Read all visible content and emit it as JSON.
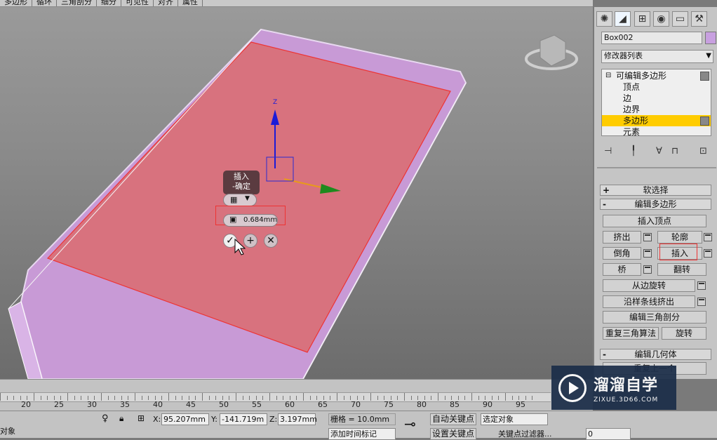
{
  "ribbon": {
    "tabs": [
      "多边形",
      "循环",
      "三角剖分",
      "细分",
      "可见性",
      "对齐",
      "属性"
    ]
  },
  "viewport": {
    "caddy": {
      "tooltip_line1": "插入",
      "tooltip_line2": "-确定",
      "amount_value": "0.684mm"
    },
    "gizmo_axis_z": "Z"
  },
  "command_panel": {
    "tab_icons": [
      "create-icon",
      "modify-icon",
      "hierarchy-icon",
      "motion-icon",
      "display-icon",
      "utilities-icon"
    ],
    "object_name": "Box002",
    "object_color": "#c8a0e0",
    "modifier_list_label": "修改器列表",
    "stack": {
      "root": "可编辑多边形",
      "sublevels": [
        "顶点",
        "边",
        "边界",
        "多边形",
        "元素"
      ],
      "selected": "多边形"
    },
    "rollouts": {
      "soft_selection": "软选择",
      "edit_polygons": "编辑多边形",
      "edit_geometry": "编辑几何体"
    },
    "buttons": {
      "insert_vertex": "插入顶点",
      "extrude": "挤出",
      "outline": "轮廓",
      "bevel": "倒角",
      "inset": "插入",
      "bridge": "桥",
      "flip": "翻转",
      "hinge_from_edge": "从边旋转",
      "extrude_along_spline": "沿样条线挤出",
      "edit_triangulation": "编辑三角剖分",
      "retriangulate": "重复三角算法",
      "turn": "旋转",
      "repeat_last": "重复上一个"
    },
    "accent_color": "#ffcc00"
  },
  "timeline": {
    "ticks": [
      "20",
      "25",
      "30",
      "35",
      "40",
      "45",
      "50",
      "55",
      "60",
      "65",
      "70",
      "75",
      "80",
      "85",
      "90",
      "95"
    ]
  },
  "status": {
    "left_label": "对象",
    "x_label": "X:",
    "x_value": "95.207mm",
    "y_label": "Y:",
    "y_value": "-141.719m",
    "z_label": "Z:",
    "z_value": "3.197mm",
    "grid": "栅格 = 10.0mm",
    "add_time_tag": "添加时间标记",
    "auto_key": "自动关键点",
    "set_key": "设置关键点",
    "selected_object": "选定对象",
    "key_filters": "关键点过滤器...",
    "frame_value": "0"
  },
  "watermark": {
    "title": "溜溜自学",
    "url": "ZIXUE.3D66.COM"
  }
}
